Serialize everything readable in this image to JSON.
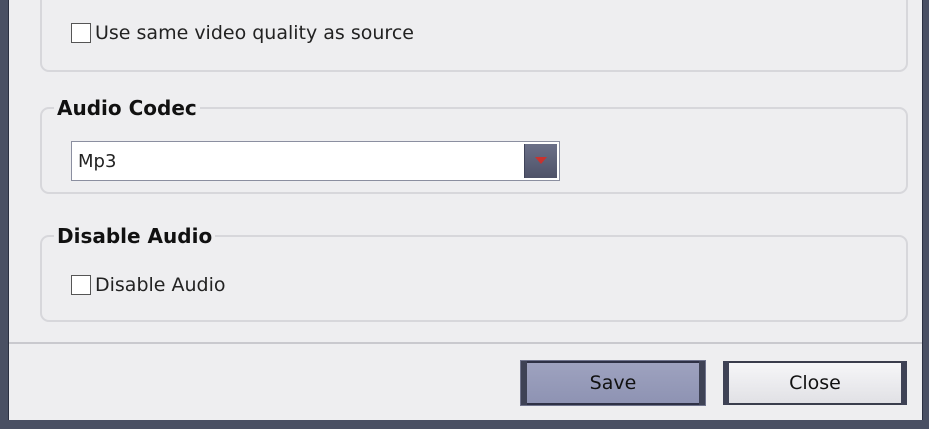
{
  "video_group": {
    "same_quality_label": "Use same video quality as source",
    "same_quality_checked": false
  },
  "audio_codec_group": {
    "title": "Audio Codec",
    "selected_value": "Mp3"
  },
  "disable_audio_group": {
    "title": "Disable Audio",
    "checkbox_label": "Disable Audio",
    "checked": false
  },
  "footer": {
    "save_label": "Save",
    "close_label": "Close"
  },
  "icons": {
    "dropdown": "chevron-down-icon"
  },
  "colors": {
    "window_bg": "#eeeef0",
    "frame": "#4a5063",
    "dropdown_arrow": "#c8322e",
    "save_button": "#9499b8"
  }
}
